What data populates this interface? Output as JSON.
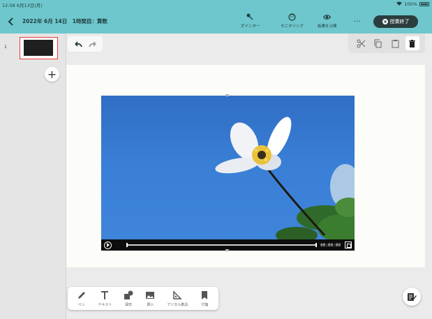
{
  "status_bar": {
    "time": "12:58",
    "date": "6月13日(月)",
    "battery": "100%"
  },
  "header": {
    "title": "2022年 6月 14日　1時間目：算数",
    "tools": [
      {
        "label": "ポインター",
        "icon": "pointer-icon"
      },
      {
        "label": "モニタリング",
        "icon": "monitoring-face-icon"
      },
      {
        "label": "板書を公開",
        "icon": "eye-icon"
      }
    ],
    "more_label": "…",
    "end_button_label": "授業終了"
  },
  "sidebar": {
    "pages": [
      {
        "number": "1",
        "selected": true
      }
    ],
    "add_label": "+"
  },
  "video": {
    "time": "00:00:00"
  },
  "bottom_tools": [
    {
      "label": "ペン",
      "icon": "pen-icon"
    },
    {
      "label": "テキスト",
      "icon": "text-icon"
    },
    {
      "label": "図形",
      "icon": "shape-icon"
    },
    {
      "label": "挿入",
      "icon": "image-insert-icon"
    },
    {
      "label": "デジタル教具",
      "icon": "triangle-ruler-icon"
    },
    {
      "label": "付箋",
      "icon": "sticky-note-icon"
    }
  ],
  "colors": {
    "header": "#6ec7cc",
    "end_button": "#2b3d3e",
    "selected_border": "#e53935"
  }
}
